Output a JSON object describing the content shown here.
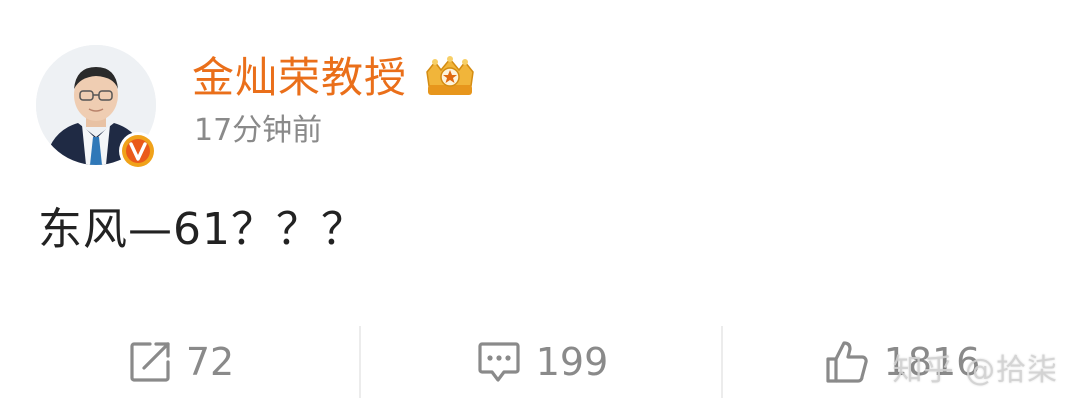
{
  "user": {
    "name": "金灿荣教授",
    "post_time": "17分钟前",
    "verified_badge_letter": "V",
    "verified_color": "#f0a21a",
    "member_badge_icon": "crown-badge-icon"
  },
  "post": {
    "text": "东风—61？？？"
  },
  "actions": {
    "repost": {
      "icon": "share-icon",
      "count": "72"
    },
    "comment": {
      "icon": "comment-icon",
      "count": "199"
    },
    "like": {
      "icon": "thumbs-up-icon",
      "count": "1816"
    }
  },
  "watermark": {
    "text": "知乎 @拾柒"
  },
  "colors": {
    "username": "#ea6f1a",
    "secondary_text": "#8a8a8a",
    "body_text": "#222222"
  }
}
